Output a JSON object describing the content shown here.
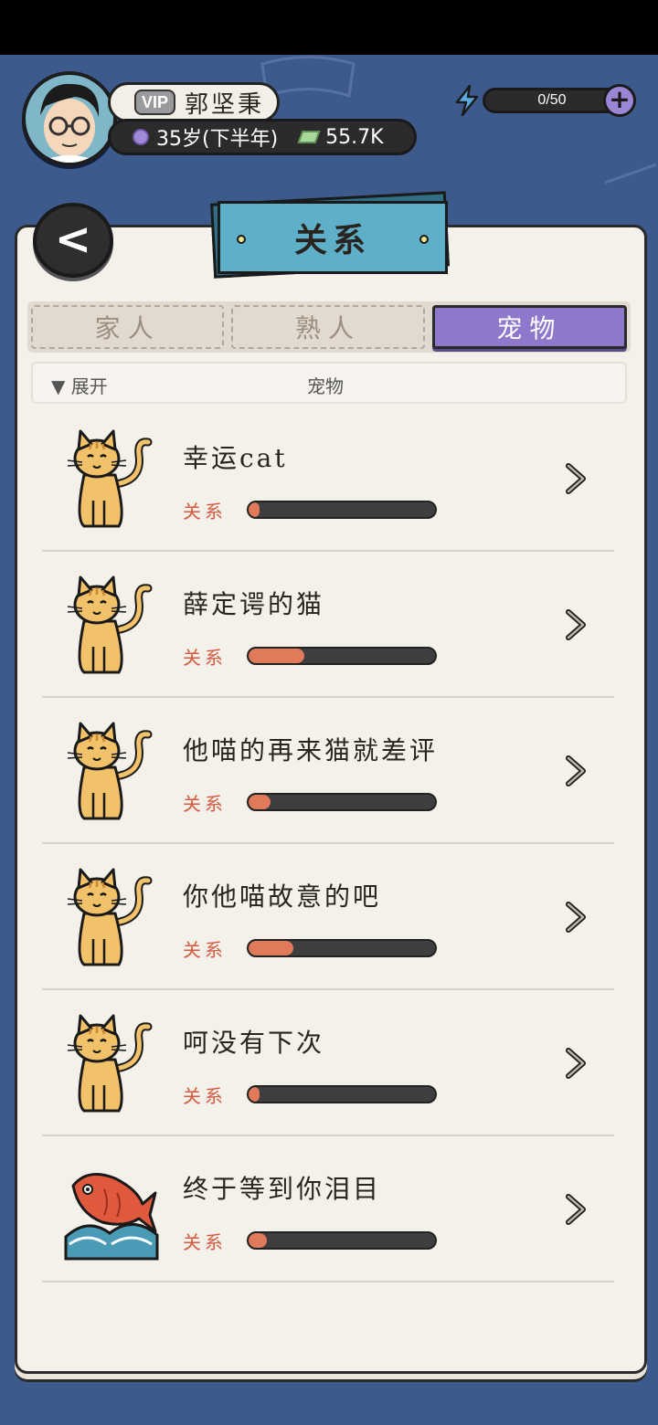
{
  "profile": {
    "vip_label": "VIP",
    "name": "郭坚秉",
    "age": "35岁(下半年)",
    "money": "55.7K"
  },
  "energy": {
    "text": "0/50",
    "plus": "+"
  },
  "panel": {
    "title": "关系",
    "back": "<"
  },
  "tabs": [
    {
      "label": "家人",
      "active": false
    },
    {
      "label": "熟人",
      "active": false
    },
    {
      "label": "宠物",
      "active": true
    }
  ],
  "filter": {
    "expand": "▼ 展开",
    "category": "宠物"
  },
  "pets": [
    {
      "name": "幸运cat",
      "relation_label": "关系",
      "relation_level": 0.06,
      "icon": "cat-icon"
    },
    {
      "name": "薛定谔的猫",
      "relation_label": "关系",
      "relation_level": 0.3,
      "icon": "cat-icon"
    },
    {
      "name": "他喵的再来猫就差评",
      "relation_label": "关系",
      "relation_level": 0.12,
      "icon": "cat-icon"
    },
    {
      "name": "你他喵故意的吧",
      "relation_label": "关系",
      "relation_level": 0.24,
      "icon": "cat-icon"
    },
    {
      "name": "呵没有下次",
      "relation_label": "关系",
      "relation_level": 0.06,
      "icon": "cat-icon"
    },
    {
      "name": "终于等到你泪目",
      "relation_label": "关系",
      "relation_level": 0.1,
      "icon": "koi-fish-icon"
    }
  ],
  "colors": {
    "background": "#3d5a8c",
    "accent_purple": "#8f78cc",
    "relation_fill": "#e07a5a",
    "banner": "#5eb0c8"
  }
}
